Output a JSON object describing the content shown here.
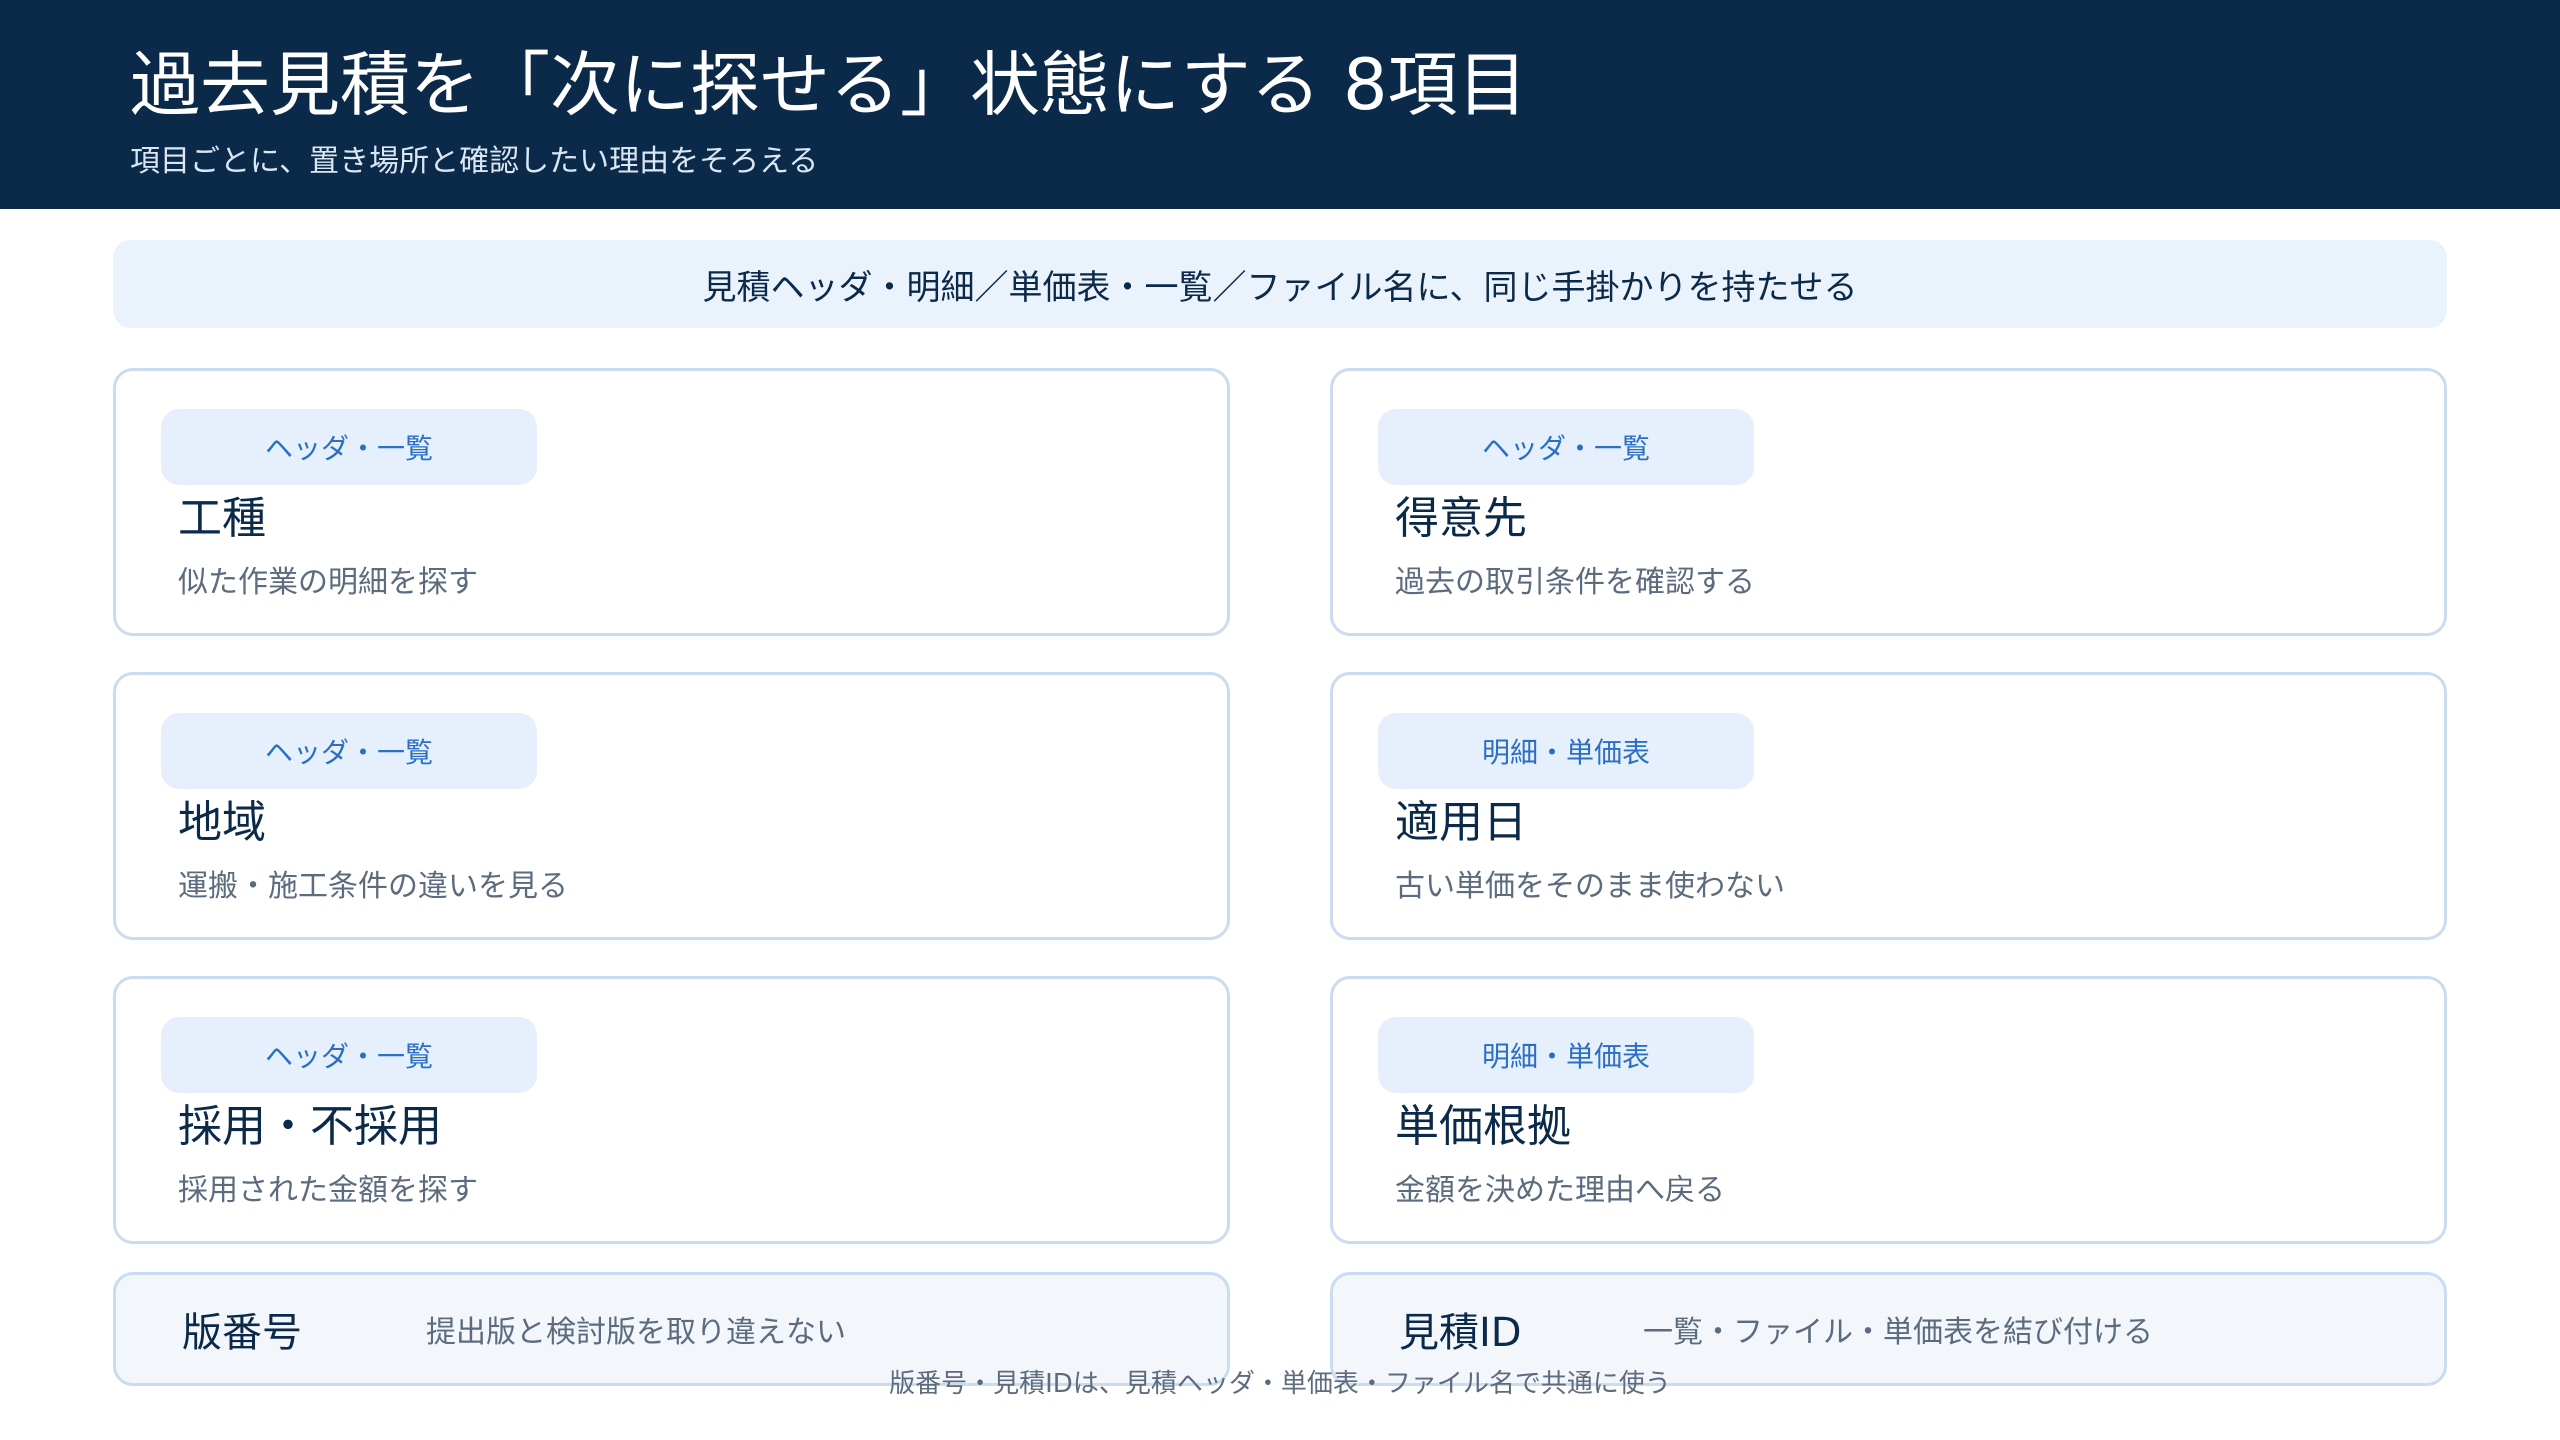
{
  "header": {
    "title": "過去見積を「次に探せる」状態にする 8項目",
    "subtitle": "項目ごとに、置き場所と確認したい理由をそろえる"
  },
  "banner": {
    "text": "見積ヘッダ・明細／単価表・一覧／ファイル名に、同じ手掛かりを持たせる"
  },
  "cards": [
    {
      "tag": "ヘッダ・一覧",
      "title": "工種",
      "desc": "似た作業の明細を探す"
    },
    {
      "tag": "ヘッダ・一覧",
      "title": "得意先",
      "desc": "過去の取引条件を確認する"
    },
    {
      "tag": "ヘッダ・一覧",
      "title": "地域",
      "desc": "運搬・施工条件の違いを見る"
    },
    {
      "tag": "明細・単価表",
      "title": "適用日",
      "desc": "古い単価をそのまま使わない"
    },
    {
      "tag": "ヘッダ・一覧",
      "title": "採用・不採用",
      "desc": "採用された金額を探す"
    },
    {
      "tag": "明細・単価表",
      "title": "単価根拠",
      "desc": "金額を決めた理由へ戻る"
    }
  ],
  "strips": [
    {
      "label": "版番号",
      "desc": "提出版と検討版を取り違えない"
    },
    {
      "label": "見積ID",
      "desc": "一覧・ファイル・単価表を結び付ける"
    }
  ],
  "footnote": "版番号・見積IDは、見積ヘッダ・単価表・ファイル名で共通に使う",
  "colors": {
    "header_bg": "#0b2a4a",
    "banner_bg": "#eaf2fc",
    "tag_bg": "#e6effc",
    "tag_text": "#2a6fc4",
    "card_border": "#c9dcf0"
  }
}
